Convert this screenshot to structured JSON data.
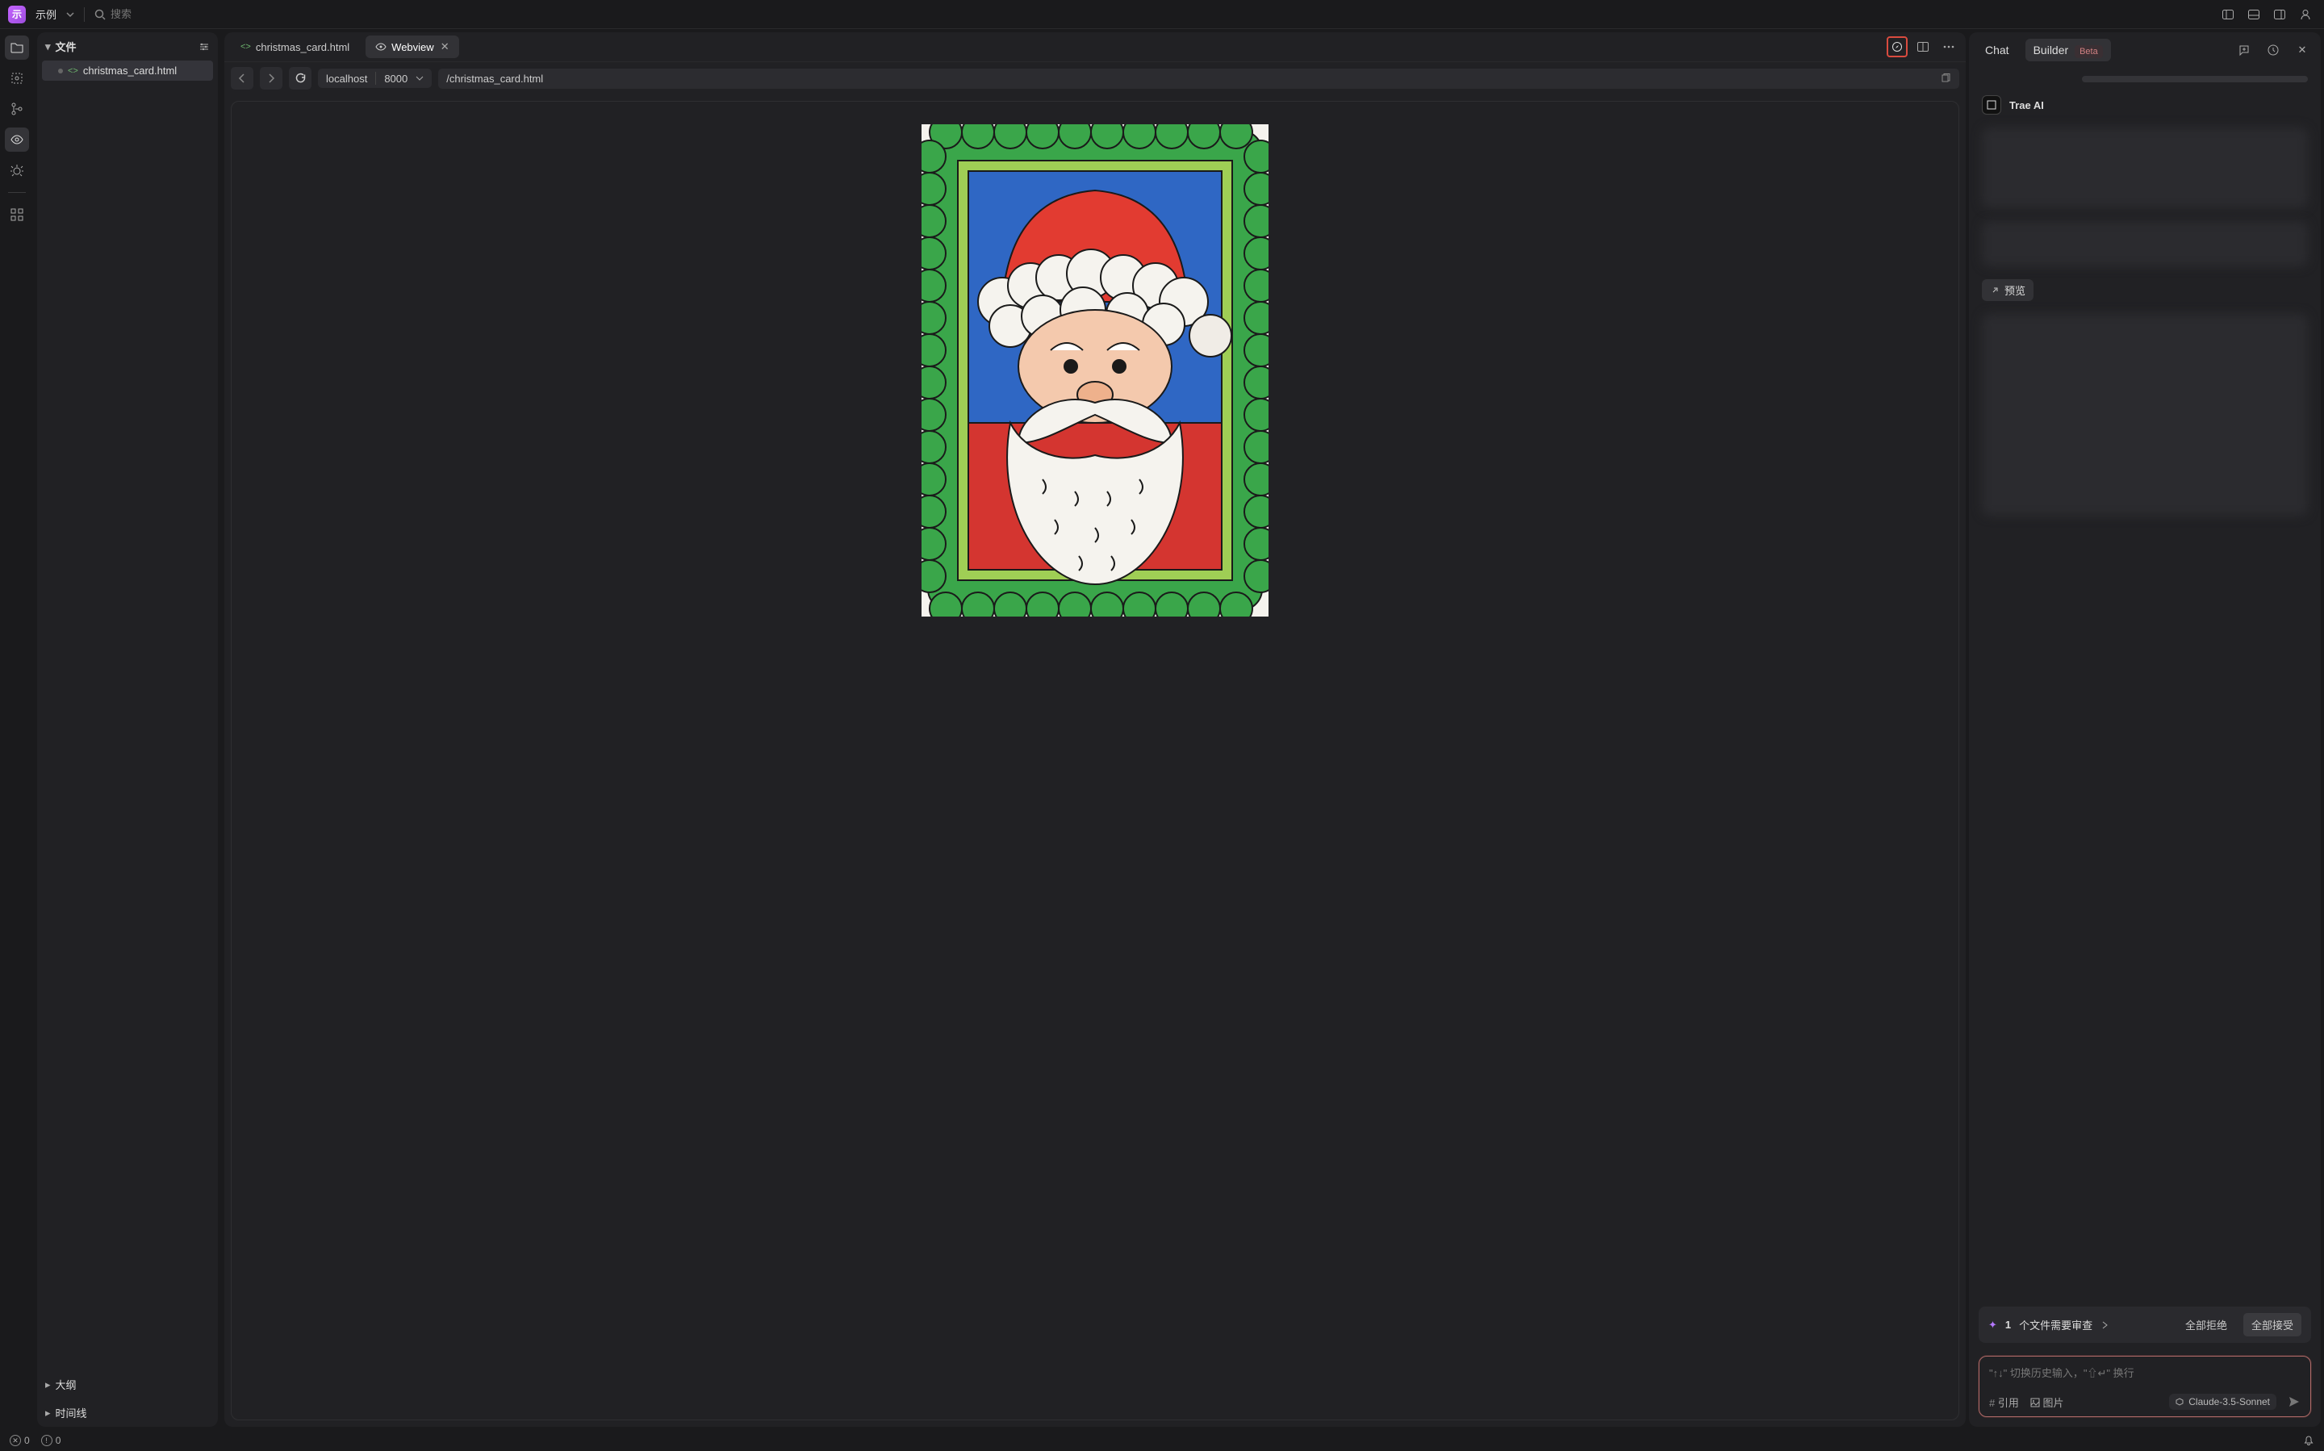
{
  "topbar": {
    "app_label": "示例",
    "app_glyph": "示",
    "search_placeholder": "搜索"
  },
  "sidebar": {
    "section_files": "文件",
    "file_name": "christmas_card.html",
    "section_outline": "大纲",
    "section_timeline": "时间线"
  },
  "tabs": {
    "tab1": "christmas_card.html",
    "tab2": "Webview"
  },
  "urlbar": {
    "host": "localhost",
    "port": "8000",
    "path": "/christmas_card.html"
  },
  "chat": {
    "tab_chat": "Chat",
    "tab_builder": "Builder",
    "beta": "Beta",
    "ai_name": "Trae AI",
    "preview_chip": "预览",
    "review": {
      "count": "1",
      "label": "个文件需要审查",
      "reject_all": "全部拒绝",
      "accept_all": "全部接受"
    },
    "input_placeholder": "\"↑↓\" 切换历史输入，\"⇧↵\" 换行",
    "attach_ref": "引用",
    "attach_img": "图片",
    "model": "Claude-3.5-Sonnet"
  },
  "status": {
    "errors": "0",
    "warnings": "0"
  }
}
